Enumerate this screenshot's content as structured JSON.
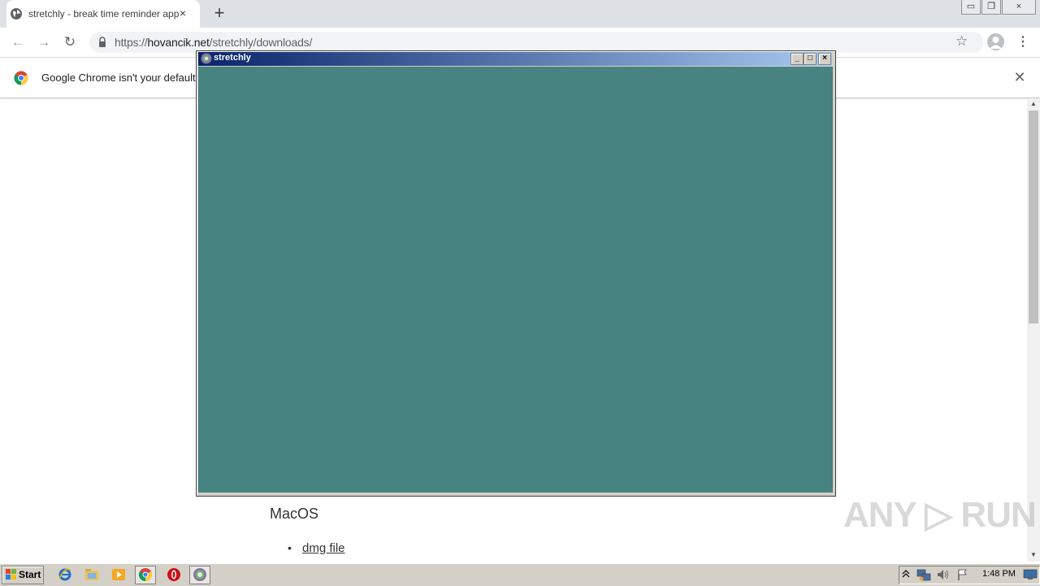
{
  "browser": {
    "tab": {
      "title": "stretchly - break time reminder app",
      "close_icon": "×"
    },
    "new_tab_icon": "+",
    "window_controls": {
      "minimize": "▭",
      "restore": "❐",
      "close": "×"
    },
    "nav": {
      "back": "←",
      "forward": "→",
      "reload": "↻"
    },
    "url": {
      "scheme": "https://",
      "host": "hovancik.net",
      "path": "/stretchly/downloads/"
    },
    "star_icon": "☆",
    "menu_icon": "⋮",
    "infobar": {
      "text": "Google Chrome isn't your default b",
      "close_icon": "✕"
    }
  },
  "page": {
    "heading": "MacOS",
    "bullet": "•",
    "link": "dmg file",
    "watermark": "ANY ▷ RUN",
    "scroll_up": "▲",
    "scroll_down": "▼"
  },
  "stretchly_window": {
    "title": "stretchly",
    "buttons": {
      "minimize": "_",
      "maximize": "□",
      "close": "×"
    },
    "client_color": "#478380"
  },
  "taskbar": {
    "start_label": "Start",
    "clock": "1:48 PM"
  },
  "colors": {
    "title_start": "#0a246a",
    "title_end": "#a6caf0",
    "chrome_frame": "#dee1e6"
  }
}
